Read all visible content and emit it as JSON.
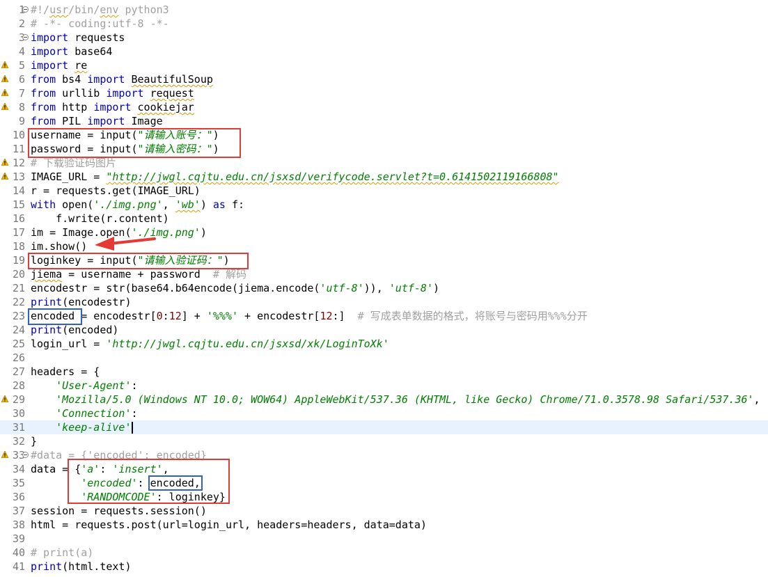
{
  "editor": {
    "lines": [
      {
        "n": "1",
        "fold": true,
        "segs": [
          [
            "cmt",
            "#!/"
          ],
          [
            "cmt sq",
            "usr"
          ],
          [
            "cmt",
            "/bin/"
          ],
          [
            "cmt sq",
            "env"
          ],
          [
            "cmt",
            " python3"
          ]
        ]
      },
      {
        "n": "2",
        "segs": [
          [
            "cmt",
            "# -*- coding:utf-8 -*-"
          ]
        ]
      },
      {
        "n": "3",
        "fold": true,
        "segs": [
          [
            "kw",
            "import"
          ],
          [
            "",
            " requests"
          ]
        ]
      },
      {
        "n": "4",
        "segs": [
          [
            "kw",
            "import"
          ],
          [
            "",
            " base64"
          ]
        ]
      },
      {
        "n": "5",
        "warn": true,
        "segs": [
          [
            "kw",
            "import"
          ],
          [
            "",
            " "
          ],
          [
            "sq",
            "re"
          ]
        ]
      },
      {
        "n": "6",
        "warn": true,
        "segs": [
          [
            "kw",
            "from"
          ],
          [
            "",
            " bs4 "
          ],
          [
            "kw",
            "import"
          ],
          [
            "",
            " "
          ],
          [
            "sq",
            "BeautifulSoup"
          ]
        ]
      },
      {
        "n": "7",
        "warn": true,
        "segs": [
          [
            "kw",
            "from"
          ],
          [
            "",
            " urllib "
          ],
          [
            "kw",
            "import"
          ],
          [
            "",
            " "
          ],
          [
            "sq",
            "request"
          ]
        ]
      },
      {
        "n": "8",
        "warn": true,
        "segs": [
          [
            "kw",
            "from"
          ],
          [
            "",
            " http "
          ],
          [
            "kw",
            "import"
          ],
          [
            "",
            " "
          ],
          [
            "sq",
            "cookiejar"
          ]
        ]
      },
      {
        "n": "9",
        "segs": [
          [
            "kw",
            "from"
          ],
          [
            "",
            " PIL "
          ],
          [
            "kw",
            "import"
          ],
          [
            "",
            " Image"
          ]
        ]
      },
      {
        "n": "10",
        "segs": [
          [
            "",
            "username = input("
          ],
          [
            "str",
            "\"请输入账号：\""
          ],
          [
            "",
            ")"
          ]
        ]
      },
      {
        "n": "11",
        "segs": [
          [
            "",
            "password = input("
          ],
          [
            "str",
            "\"请输入密码：\""
          ],
          [
            "",
            ")"
          ]
        ]
      },
      {
        "n": "12",
        "warn": true,
        "segs": [
          [
            "cmt",
            "# 下载验证码图片"
          ]
        ]
      },
      {
        "n": "13",
        "warn": true,
        "segs": [
          [
            "",
            "IMAGE_URL = "
          ],
          [
            "str sq",
            "\"http://jwgl.cqjtu.edu.cn/jsxsd/verifycode.servlet?t=0.6141502119166808\""
          ]
        ]
      },
      {
        "n": "14",
        "segs": [
          [
            "",
            "r = requests.get(IMAGE_URL)"
          ]
        ]
      },
      {
        "n": "15",
        "segs": [
          [
            "kw",
            "with"
          ],
          [
            "",
            " open("
          ],
          [
            "str",
            "'./img.png'"
          ],
          [
            "",
            ", "
          ],
          [
            "str sq",
            "'wb'"
          ],
          [
            "",
            ") "
          ],
          [
            "kw",
            "as"
          ],
          [
            "",
            " f:"
          ]
        ]
      },
      {
        "n": "16",
        "segs": [
          [
            "",
            "    f.write(r.content)"
          ]
        ]
      },
      {
        "n": "17",
        "segs": [
          [
            "",
            "im = Image.open("
          ],
          [
            "str",
            "'./img.png'"
          ],
          [
            "",
            ")"
          ]
        ]
      },
      {
        "n": "18",
        "segs": [
          [
            "",
            "im.show()"
          ]
        ]
      },
      {
        "n": "19",
        "segs": [
          [
            "",
            "loginkey = input("
          ],
          [
            "str",
            "\"请输入验证码：\""
          ],
          [
            "",
            ")"
          ]
        ]
      },
      {
        "n": "20",
        "segs": [
          [
            "sq",
            "jiema"
          ],
          [
            "",
            " = username + password  "
          ],
          [
            "cmt",
            "# 解码"
          ]
        ]
      },
      {
        "n": "21",
        "segs": [
          [
            "",
            "encodestr = str(base64.b64encode(jiema.encode("
          ],
          [
            "str",
            "'utf-8'"
          ],
          [
            "",
            ")), "
          ],
          [
            "str",
            "'utf-8'"
          ],
          [
            "",
            ")"
          ]
        ]
      },
      {
        "n": "22",
        "segs": [
          [
            "kw",
            "print"
          ],
          [
            "",
            "(encodestr)"
          ]
        ]
      },
      {
        "n": "23",
        "segs": [
          [
            "",
            "encoded = encodestr["
          ],
          [
            "num",
            "0"
          ],
          [
            "",
            ":"
          ],
          [
            "num",
            "12"
          ],
          [
            "",
            "] + "
          ],
          [
            "str",
            "'%%%'"
          ],
          [
            "",
            " + encodestr["
          ],
          [
            "num",
            "12"
          ],
          [
            "",
            ":]  "
          ],
          [
            "cmt",
            "# 写成表单数据的格式，将账号与密码用%%%分开"
          ]
        ]
      },
      {
        "n": "24",
        "segs": [
          [
            "kw",
            "print"
          ],
          [
            "",
            "(encoded)"
          ]
        ]
      },
      {
        "n": "25",
        "segs": [
          [
            "",
            "login_url = "
          ],
          [
            "str",
            "'http://jwgl.cqjtu.edu.cn/jsxsd/xk/LoginToXk'"
          ]
        ]
      },
      {
        "n": "26",
        "segs": []
      },
      {
        "n": "27",
        "segs": [
          [
            "",
            "headers = {"
          ]
        ]
      },
      {
        "n": "28",
        "segs": [
          [
            "",
            "    "
          ],
          [
            "str",
            "'User-Agent'"
          ],
          [
            "",
            ":"
          ]
        ]
      },
      {
        "n": "29",
        "warn": true,
        "segs": [
          [
            "",
            "    "
          ],
          [
            "str",
            "'Mozilla/5.0 (Windows NT 10.0; WOW64) AppleWebKit/537.36 (KHTML, like Gecko) Chrome/71.0.3578.98 Safari/537.36'"
          ],
          [
            "",
            ","
          ]
        ]
      },
      {
        "n": "30",
        "segs": [
          [
            "",
            "    "
          ],
          [
            "str",
            "'Connection'"
          ],
          [
            "",
            ":"
          ]
        ]
      },
      {
        "n": "31",
        "current": true,
        "caret": true,
        "segs": [
          [
            "",
            "    "
          ],
          [
            "str",
            "'keep-alive'"
          ]
        ]
      },
      {
        "n": "32",
        "segs": [
          [
            "",
            "}"
          ]
        ]
      },
      {
        "n": "33",
        "warn": true,
        "fold": true,
        "segs": [
          [
            "cmt",
            "#data = {'encoded': encoded}"
          ]
        ]
      },
      {
        "n": "34",
        "segs": [
          [
            "",
            "data = {"
          ],
          [
            "str",
            "'a'"
          ],
          [
            "",
            ": "
          ],
          [
            "str",
            "'insert'"
          ],
          [
            "",
            ","
          ]
        ]
      },
      {
        "n": "35",
        "segs": [
          [
            "",
            "        "
          ],
          [
            "str",
            "'encoded'"
          ],
          [
            "",
            ": encoded,"
          ]
        ]
      },
      {
        "n": "36",
        "segs": [
          [
            "",
            "        "
          ],
          [
            "str",
            "'RANDOMCODE'"
          ],
          [
            "",
            ": loginkey}"
          ]
        ]
      },
      {
        "n": "37",
        "segs": [
          [
            "",
            "session = requests.session()"
          ]
        ]
      },
      {
        "n": "38",
        "segs": [
          [
            "",
            "html = requests.post(url=login_url, headers=headers, data=data)"
          ]
        ]
      },
      {
        "n": "39",
        "segs": []
      },
      {
        "n": "40",
        "segs": [
          [
            "cmt",
            "# print(a)"
          ]
        ]
      },
      {
        "n": "41",
        "segs": [
          [
            "kw",
            "print"
          ],
          [
            "",
            "(html.text)"
          ]
        ]
      }
    ]
  },
  "colors": {
    "keyword": "#0000c0",
    "string": "#008000",
    "number": "#800000",
    "comment": "#a0a0a0",
    "line_number": "#787878",
    "current_line": "#e8f2fe",
    "highlight_red": "#e53935",
    "highlight_blue": "#2f5fcb",
    "warning": "#f0b400"
  },
  "icons": {
    "warning": "warning-icon",
    "fold": "fold-toggle-icon",
    "arrow": "arrow-annotation"
  }
}
